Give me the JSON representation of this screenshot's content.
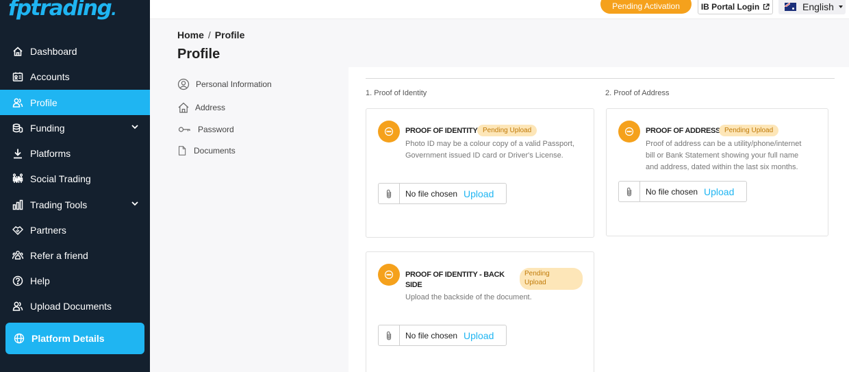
{
  "brand": {
    "logo_text": "fptrading",
    "logo_dot": ".",
    "accent_color": "#1fb5f2",
    "sidebar_bg": "#14202e",
    "orange": "#f5a11c"
  },
  "sidebar": {
    "items": [
      {
        "label": "Dashboard",
        "icon": "home-icon"
      },
      {
        "label": "Accounts",
        "icon": "accounts-icon"
      },
      {
        "label": "Profile",
        "icon": "users-icon",
        "active": true
      },
      {
        "label": "Funding",
        "icon": "funding-icon",
        "expandable": true
      },
      {
        "label": "Platforms",
        "icon": "download-icon"
      },
      {
        "label": "Social Trading",
        "icon": "social-icon"
      },
      {
        "label": "Trading Tools",
        "icon": "chart-icon",
        "expandable": true
      },
      {
        "label": "Partners",
        "icon": "handshake-icon"
      },
      {
        "label": "Refer a friend",
        "icon": "refer-icon"
      },
      {
        "label": "Help",
        "icon": "help-icon"
      },
      {
        "label": "Upload Documents",
        "icon": "users-icon"
      }
    ],
    "platform_details": "Platform Details"
  },
  "topbar": {
    "pending_activation": "Pending Activation",
    "ib_portal_login": "IB Portal Login",
    "language": "English"
  },
  "breadcrumb": {
    "home": "Home",
    "separator": "/",
    "current": "Profile"
  },
  "page_title": "Profile",
  "profile_menu": [
    {
      "label": "Personal Information",
      "icon": "user-circle-icon"
    },
    {
      "label": "Address",
      "icon": "home-icon"
    },
    {
      "label": "Password",
      "icon": "key-icon"
    },
    {
      "label": "Documents",
      "icon": "document-icon"
    }
  ],
  "sections": {
    "identity_label": "1. Proof of Identity",
    "address_label": "2. Proof of Address"
  },
  "cards": {
    "identity": {
      "title": "PROOF OF IDENTITY",
      "badge": "Pending Upload",
      "desc1": "Photo ID may be a colour copy of a valid Passport,",
      "desc2": "Government issued ID card or Driver's License.",
      "file_status": "No file chosen",
      "upload": "Upload"
    },
    "address": {
      "title": "PROOF OF ADDRESS",
      "badge": "Pending Upload",
      "desc1": "Proof of address can be a utility/phone/internet",
      "desc2": "bill or Bank Statement showing your full name",
      "desc3": "and address, dated within the last six months.",
      "file_status": "No file chosen",
      "upload": "Upload"
    },
    "backside": {
      "title1": "PROOF OF IDENTITY - BACK",
      "title2": "SIDE",
      "badge1": "Pending",
      "badge2": "Upload",
      "desc1": "Upload the backside of the document.",
      "file_status": "No file chosen",
      "upload": "Upload"
    }
  }
}
